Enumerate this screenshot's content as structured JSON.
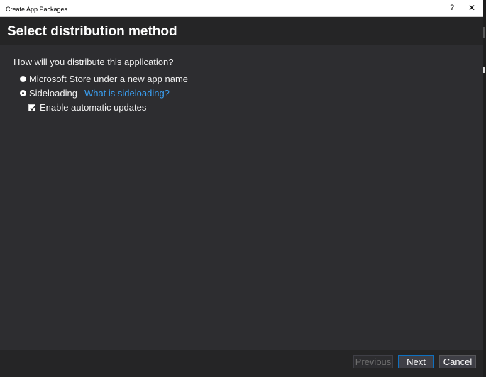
{
  "window": {
    "title": "Create App Packages",
    "help_label": "?",
    "close_label": "✕"
  },
  "header": {
    "title": "Select distribution method"
  },
  "content": {
    "question": "How will you distribute this application?",
    "options": [
      {
        "label": "Microsoft Store under a new app name",
        "selected": false
      },
      {
        "label": "Sideloading",
        "selected": true,
        "link": "What is sideloading?"
      }
    ],
    "auto_update": {
      "label": "Enable automatic updates",
      "checked": true
    }
  },
  "footer": {
    "previous_label": "Previous",
    "next_label": "Next",
    "cancel_label": "Cancel"
  },
  "colors": {
    "background": "#2d2d30",
    "header": "#252526",
    "link": "#3aa0f3",
    "accent_border": "#0e70c0"
  }
}
